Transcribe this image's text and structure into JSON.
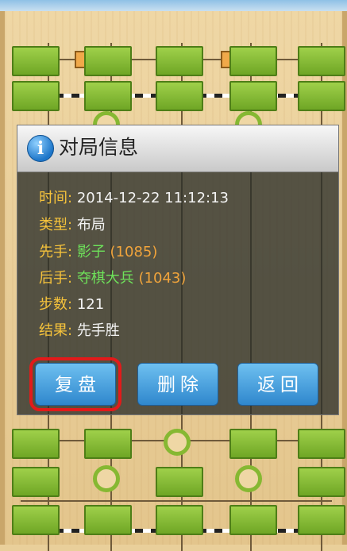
{
  "dialog": {
    "title": "对局信息",
    "icon": "info-icon",
    "fields": {
      "time_label": "时间:",
      "time_value": "2014-12-22 11:12:13",
      "type_label": "类型:",
      "type_value": "布局",
      "first_label": "先手:",
      "first_name": "影子",
      "first_rating": "(1085)",
      "second_label": "后手:",
      "second_name": "夺棋大兵",
      "second_rating": "(1043)",
      "steps_label": "步数:",
      "steps_value": "121",
      "result_label": "结果:",
      "result_value": "先手胜"
    },
    "buttons": {
      "replay": "复盘",
      "delete": "删除",
      "back": "返回"
    }
  },
  "colors": {
    "label": "#f5c23b",
    "name": "#6ee25a",
    "rating": "#f1a43b",
    "button": "#3b93d6",
    "highlight": "#e21a1a",
    "piece": "#8cc63f"
  }
}
